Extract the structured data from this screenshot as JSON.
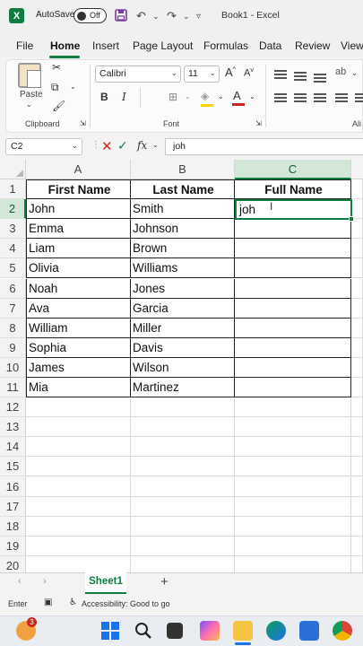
{
  "titlebar": {
    "app_icon_letter": "X",
    "autosave_label": "AutoSave",
    "autosave_state": "Off",
    "document_title": "Book1  -  Excel",
    "icons": [
      "save-icon",
      "undo-icon",
      "redo-icon",
      "customize-icon"
    ]
  },
  "menu": {
    "items": [
      "File",
      "Home",
      "Insert",
      "Page Layout",
      "Formulas",
      "Data",
      "Review",
      "View"
    ],
    "active": "Home"
  },
  "ribbon": {
    "clipboard": {
      "paste_label": "Paste",
      "group_label": "Clipboard"
    },
    "font": {
      "name": "Calibri",
      "size": "11",
      "grow": "A",
      "shrink": "A",
      "bold": "B",
      "italic": "I",
      "group_label": "Font",
      "font_color": "#c42b1c",
      "fill_color": "#ffd400"
    },
    "alignment_label_partial": "Ali"
  },
  "formula_bar": {
    "name_box": "C2",
    "cancel_glyph": "✕",
    "enter_glyph": "✓",
    "fx_label": "fx",
    "value": "joh"
  },
  "grid": {
    "columns": [
      "A",
      "B",
      "C"
    ],
    "selected_column": "C",
    "rows": [
      "1",
      "2",
      "3",
      "4",
      "5",
      "6",
      "7",
      "8",
      "9",
      "10",
      "11",
      "12",
      "13",
      "14",
      "15",
      "16",
      "17",
      "18",
      "19",
      "20"
    ],
    "selected_row": "2",
    "header_cells": [
      "First Name",
      "Last Name",
      "Full Name"
    ],
    "data_rows": [
      [
        "John",
        "Smith"
      ],
      [
        "Emma",
        "Johnson"
      ],
      [
        "Liam",
        "Brown"
      ],
      [
        "Olivia",
        "Williams"
      ],
      [
        "Noah",
        "Jones"
      ],
      [
        "Ava",
        "Garcia"
      ],
      [
        "William",
        "Miller"
      ],
      [
        "Sophia",
        "Davis"
      ],
      [
        "James",
        "Wilson"
      ],
      [
        "Mia",
        "Martinez"
      ]
    ],
    "active_cell_value": "joh"
  },
  "sheets": {
    "tabs": [
      "Sheet1"
    ],
    "add_label": "+"
  },
  "status": {
    "mode": "Enter",
    "accessibility": "Accessibility: Good to go"
  },
  "taskbar": {
    "notification_count": "3"
  },
  "colors": {
    "excel_green": "#107c41",
    "selected_header": "#d3e7d9"
  }
}
